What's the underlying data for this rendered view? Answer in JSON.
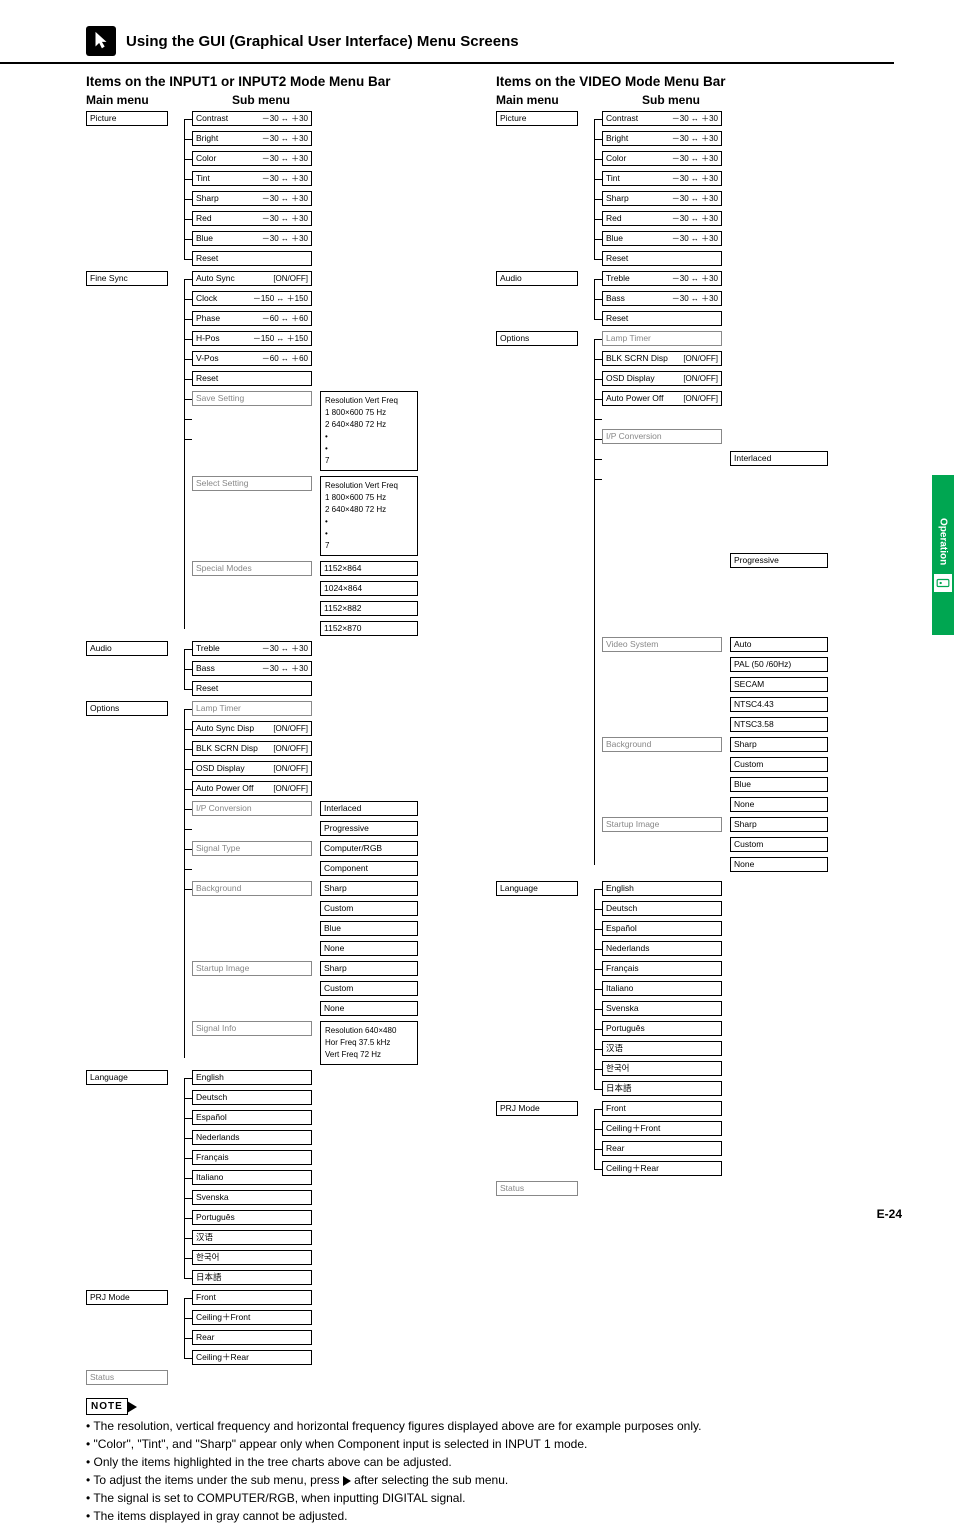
{
  "header": {
    "title": "Using the GUI (Graphical User Interface) Menu Screens"
  },
  "side_tab": "Operation",
  "page_number": "E-24",
  "range_std": "－30 ↔ ＋30",
  "range_150": "－150 ↔ ＋150",
  "range_60": "－60 ↔ ＋60",
  "onoff": "[ON/OFF]",
  "left": {
    "title": "Items on the INPUT1 or INPUT2 Mode Menu Bar",
    "main_header": "Main menu",
    "sub_header": "Sub menu",
    "groups": [
      {
        "main": "Picture",
        "subs": [
          {
            "n": "Contrast",
            "v": "－30 ↔ ＋30"
          },
          {
            "n": "Bright",
            "v": "－30 ↔ ＋30"
          },
          {
            "n": "Color",
            "v": "－30 ↔ ＋30"
          },
          {
            "n": "Tint",
            "v": "－30 ↔ ＋30"
          },
          {
            "n": "Sharp",
            "v": "－30 ↔ ＋30"
          },
          {
            "n": "Red",
            "v": "－30 ↔ ＋30"
          },
          {
            "n": "Blue",
            "v": "－30 ↔ ＋30"
          },
          {
            "n": "Reset",
            "v": ""
          }
        ]
      },
      {
        "main": "Fine Sync",
        "subs": [
          {
            "n": "Auto Sync",
            "v": "[ON/OFF]"
          },
          {
            "n": "Clock",
            "v": "－150 ↔ ＋150"
          },
          {
            "n": "Phase",
            "v": "－60 ↔ ＋60"
          },
          {
            "n": "H-Pos",
            "v": "－150 ↔ ＋150"
          },
          {
            "n": "V-Pos",
            "v": "－60 ↔ ＋60"
          },
          {
            "n": "Reset",
            "v": ""
          },
          {
            "n": "Save Setting",
            "v": "",
            "gray": true
          },
          {
            "n": "Select Setting",
            "v": "",
            "gray": true
          },
          {
            "n": "Special Modes",
            "v": "",
            "gray": true
          }
        ]
      },
      {
        "main": "Audio",
        "subs": [
          {
            "n": "Treble",
            "v": "－30 ↔ ＋30"
          },
          {
            "n": "Bass",
            "v": "－30 ↔ ＋30"
          },
          {
            "n": "Reset",
            "v": ""
          }
        ]
      },
      {
        "main": "Options",
        "subs": [
          {
            "n": "Lamp Timer",
            "v": "",
            "gray": true
          },
          {
            "n": "Auto Sync Disp",
            "v": "[ON/OFF]"
          },
          {
            "n": "BLK SCRN Disp",
            "v": "[ON/OFF]"
          },
          {
            "n": "OSD Display",
            "v": "[ON/OFF]"
          },
          {
            "n": "Auto Power Off",
            "v": "[ON/OFF]"
          },
          {
            "n": "I/P Conversion",
            "v": "",
            "gray": true
          },
          {
            "n": "Signal Type",
            "v": "",
            "gray": true
          },
          {
            "n": "Background",
            "v": "",
            "gray": true
          },
          {
            "n": "Startup Image",
            "v": "",
            "gray": true
          },
          {
            "n": "Signal Info",
            "v": "",
            "gray": true
          }
        ]
      },
      {
        "main": "Language",
        "subs": [
          {
            "n": "English"
          },
          {
            "n": "Deutsch"
          },
          {
            "n": "Español"
          },
          {
            "n": "Nederlands"
          },
          {
            "n": "Français"
          },
          {
            "n": "Italiano"
          },
          {
            "n": "Svenska"
          },
          {
            "n": "Português"
          },
          {
            "n": "汉语"
          },
          {
            "n": "한국어"
          },
          {
            "n": "日本語"
          }
        ]
      },
      {
        "main": "PRJ Mode",
        "subs": [
          {
            "n": "Front"
          },
          {
            "n": "Ceiling＋Front"
          },
          {
            "n": "Rear"
          },
          {
            "n": "Ceiling＋Rear"
          }
        ]
      },
      {
        "main": "Status",
        "subs": [],
        "gray": true
      }
    ],
    "side_panels": {
      "save_setting": {
        "head": "Resolution      Vert Freq",
        "rows": [
          "1     800×600        75 Hz",
          "2     640×480        72 Hz",
          "•",
          "•",
          "7"
        ]
      },
      "select_setting": {
        "head": "Resolution      Vert Freq",
        "rows": [
          "1     800×600        75 Hz",
          "2     640×480        72 Hz",
          "•",
          "•",
          "7"
        ]
      },
      "special_modes": [
        "1152×864",
        "1024×864",
        "1152×882",
        "1152×870"
      ],
      "ip_conversion": [
        "Interlaced",
        "Progressive"
      ],
      "signal_type": [
        "Computer/RGB",
        "Component"
      ],
      "background": [
        "Sharp",
        "Custom",
        "Blue",
        "None"
      ],
      "startup_image": [
        "Sharp",
        "Custom",
        "None"
      ],
      "signal_info": {
        "rows": [
          "Resolution      640×480",
          "Hor Freq         37.5 kHz",
          "Vert Freq        72 Hz"
        ]
      }
    }
  },
  "right": {
    "title": "Items on the VIDEO Mode Menu Bar",
    "main_header": "Main menu",
    "sub_header": "Sub menu",
    "groups": [
      {
        "main": "Picture",
        "subs": [
          {
            "n": "Contrast",
            "v": "－30 ↔ ＋30"
          },
          {
            "n": "Bright",
            "v": "－30 ↔ ＋30"
          },
          {
            "n": "Color",
            "v": "－30 ↔ ＋30"
          },
          {
            "n": "Tint",
            "v": "－30 ↔ ＋30"
          },
          {
            "n": "Sharp",
            "v": "－30 ↔ ＋30"
          },
          {
            "n": "Red",
            "v": "－30 ↔ ＋30"
          },
          {
            "n": "Blue",
            "v": "－30 ↔ ＋30"
          },
          {
            "n": "Reset",
            "v": ""
          }
        ]
      },
      {
        "main": "Audio",
        "subs": [
          {
            "n": "Treble",
            "v": "－30 ↔ ＋30"
          },
          {
            "n": "Bass",
            "v": "－30 ↔ ＋30"
          },
          {
            "n": "Reset",
            "v": ""
          }
        ]
      },
      {
        "main": "Options",
        "subs": [
          {
            "n": "Lamp Timer",
            "v": "",
            "gray": true
          },
          {
            "n": "BLK SCRN Disp",
            "v": "[ON/OFF]"
          },
          {
            "n": "OSD Display",
            "v": "[ON/OFF]"
          },
          {
            "n": "Auto Power Off",
            "v": "[ON/OFF]"
          },
          {
            "n": "I/P Conversion",
            "v": "",
            "gray": true
          },
          {
            "n": "Video System",
            "v": "",
            "gray": true
          },
          {
            "n": "Background",
            "v": "",
            "gray": true
          },
          {
            "n": "Startup Image",
            "v": "",
            "gray": true
          }
        ]
      },
      {
        "main": "Language",
        "subs": [
          {
            "n": "English"
          },
          {
            "n": "Deutsch"
          },
          {
            "n": "Español"
          },
          {
            "n": "Nederlands"
          },
          {
            "n": "Français"
          },
          {
            "n": "Italiano"
          },
          {
            "n": "Svenska"
          },
          {
            "n": "Português"
          },
          {
            "n": "汉语"
          },
          {
            "n": "한국어"
          },
          {
            "n": "日本語"
          }
        ]
      },
      {
        "main": "PRJ Mode",
        "subs": [
          {
            "n": "Front"
          },
          {
            "n": "Ceiling＋Front"
          },
          {
            "n": "Rear"
          },
          {
            "n": "Ceiling＋Rear"
          }
        ]
      },
      {
        "main": "Status",
        "subs": [],
        "gray": true
      }
    ],
    "side_panels": {
      "ip_conversion": [
        "Interlaced",
        "Progressive"
      ],
      "video_system": [
        "Auto",
        "PAL (50 /60Hz)",
        "SECAM",
        "NTSC4.43",
        "NTSC3.58"
      ],
      "background": [
        "Sharp",
        "Custom",
        "Blue",
        "None"
      ],
      "startup_image": [
        "Sharp",
        "Custom",
        "None"
      ]
    }
  },
  "notes": {
    "label": "NOTE",
    "items": [
      "The resolution, vertical frequency and horizontal frequency figures displayed above are for example purposes only.",
      "\"Color\", \"Tint\", and \"Sharp\" appear only when Component input is selected in INPUT 1 mode.",
      "Only the items highlighted in the tree charts above can be adjusted.",
      "To adjust the items under the sub menu, press ▶ after selecting the sub menu.",
      "The signal is set to COMPUTER/RGB, when inputting DIGITAL signal.",
      "The items displayed in gray cannot be adjusted."
    ]
  }
}
